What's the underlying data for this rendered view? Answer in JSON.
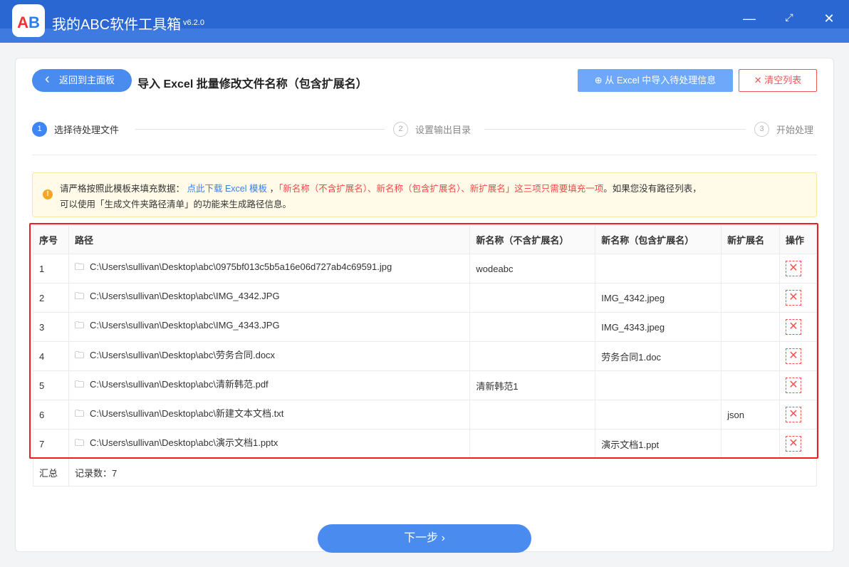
{
  "app": {
    "title": "我的ABC软件工具箱",
    "version": "v6.2.0",
    "logo_text": "AB"
  },
  "header": {
    "back_label": "返回到主面板",
    "page_title": "导入 Excel 批量修改文件名称（包含扩展名）",
    "import_label": "从 Excel 中导入待处理信息",
    "clear_label": "清空列表"
  },
  "steps": [
    {
      "num": "1",
      "label": "选择待处理文件"
    },
    {
      "num": "2",
      "label": "设置输出目录"
    },
    {
      "num": "3",
      "label": "开始处理"
    }
  ],
  "notice": {
    "p1": "请严格按照此模板来填充数据：",
    "link": "点此下载 Excel 模板",
    "p2": "，",
    "red": "「新名称（不含扩展名）、新名称（包含扩展名）、新扩展名」这三项只需要填充一项",
    "p3": "。如果您没有路径列表，",
    "p4": "可以使用「生成文件夹路径清单」的功能来生成路径信息。"
  },
  "table": {
    "headers": [
      "序号",
      "路径",
      "新名称（不含扩展名）",
      "新名称（包含扩展名）",
      "新扩展名",
      "操作"
    ],
    "rows": [
      [
        "1",
        "C:\\Users\\sullivan\\Desktop\\abc\\0975bf013c5b5a16e06d727ab4c69591.jpg",
        "wodeabc",
        "",
        ""
      ],
      [
        "2",
        "C:\\Users\\sullivan\\Desktop\\abc\\IMG_4342.JPG",
        "",
        "IMG_4342.jpeg",
        ""
      ],
      [
        "3",
        "C:\\Users\\sullivan\\Desktop\\abc\\IMG_4343.JPG",
        "",
        "IMG_4343.jpeg",
        ""
      ],
      [
        "4",
        "C:\\Users\\sullivan\\Desktop\\abc\\劳务合同.docx",
        "",
        "劳务合同1.doc",
        ""
      ],
      [
        "5",
        "C:\\Users\\sullivan\\Desktop\\abc\\清新韩范.pdf",
        "清新韩范1",
        "",
        ""
      ],
      [
        "6",
        "C:\\Users\\sullivan\\Desktop\\abc\\新建文本文档.txt",
        "",
        "",
        "json"
      ],
      [
        "7",
        "C:\\Users\\sullivan\\Desktop\\abc\\演示文档1.pptx",
        "",
        "演示文档1.ppt",
        ""
      ]
    ],
    "summary_label": "汇总",
    "summary_value": "记录数：7"
  },
  "footer": {
    "next_label": "下一步"
  }
}
